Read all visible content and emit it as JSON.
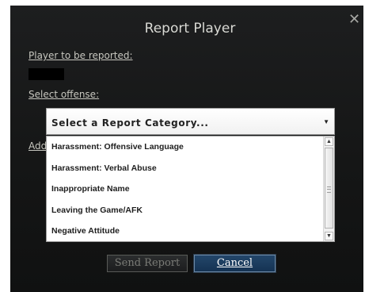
{
  "dialog": {
    "title": "Report Player",
    "close_glyph": "✕",
    "player_label": "Player to be reported:",
    "offense_label": "Select offense:",
    "additional_label_partial": "Add"
  },
  "select": {
    "selected": "Select a Report Category...",
    "arrow_glyph": "▼"
  },
  "options": [
    "Harassment: Offensive Language",
    "Harassment: Verbal Abuse",
    "Inappropriate Name",
    "Leaving the Game/AFK",
    "Negative Attitude"
  ],
  "scrollbar": {
    "up_glyph": "▲",
    "down_glyph": "▼"
  },
  "buttons": {
    "send": "Send Report",
    "cancel": "Cancel"
  },
  "colors": {
    "dialog_bg": "#171818",
    "label_text": "#c7c7bf",
    "cancel_bg": "#1c3d60",
    "send_text_disabled": "#7a7b76"
  }
}
